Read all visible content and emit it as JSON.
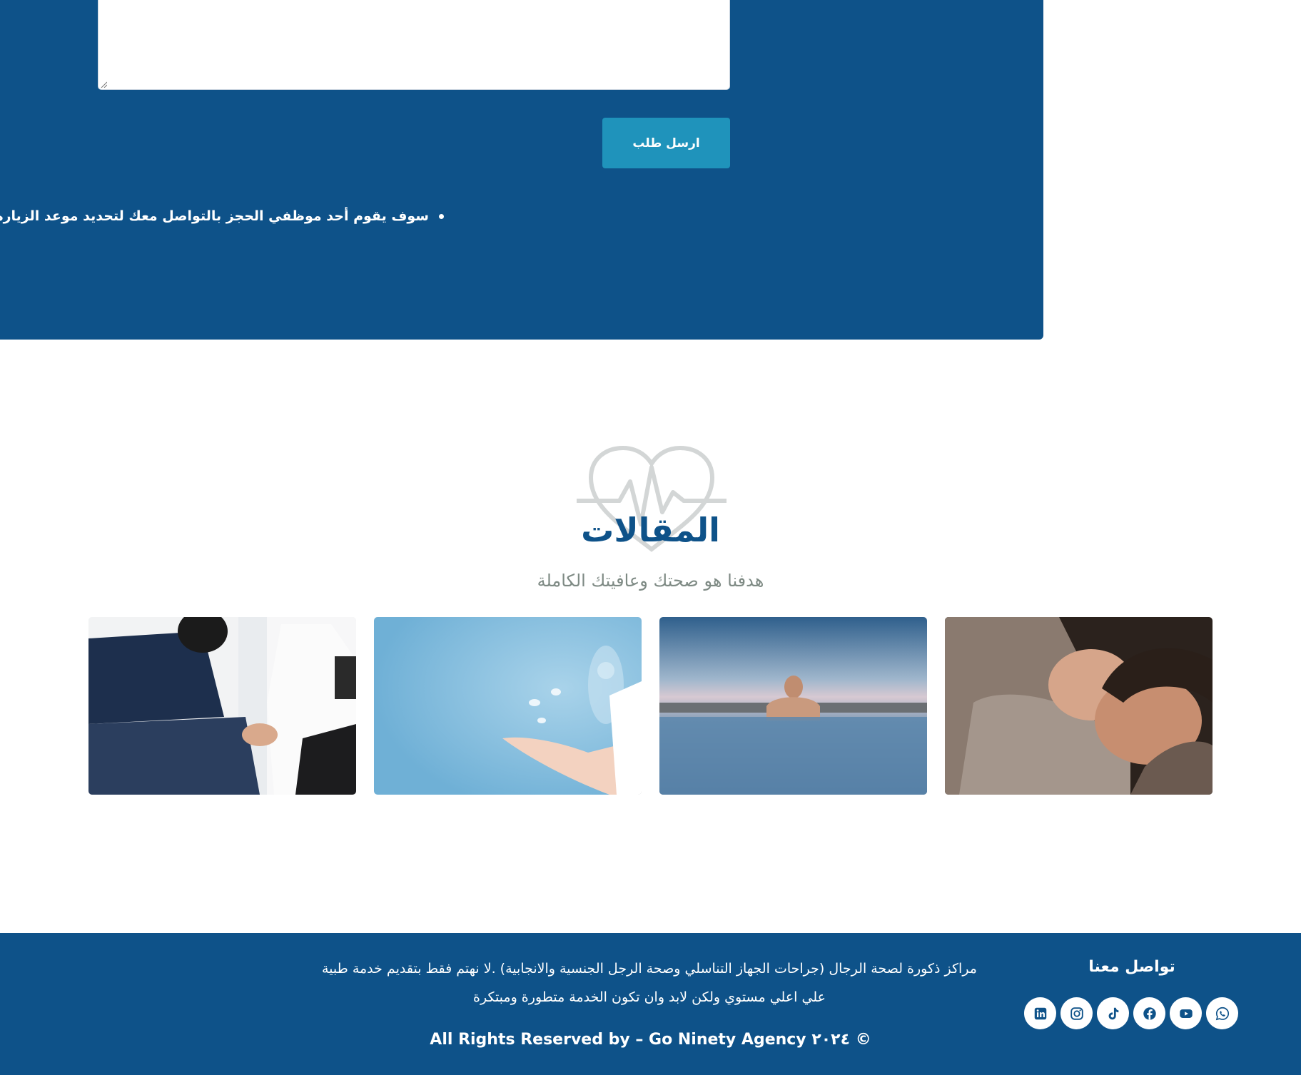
{
  "booking": {
    "textarea_value": "",
    "submit_label": "ارسل طلب",
    "note": "سوف يقوم أحد موظفي الحجز بالتواصل معك لتحديد موعد الزيارة"
  },
  "articles": {
    "title": "المقالات",
    "subtitle": "هدفنا هو صحتك وعافيتك الكاملة",
    "cards": [
      {
        "image": "father-with-newborn-photo"
      },
      {
        "image": "man-in-water-photo"
      },
      {
        "image": "hand-with-sperm-photo"
      },
      {
        "image": "patient-with-doctor-photo"
      }
    ]
  },
  "footer": {
    "contact_title": "تواصل معنا",
    "about": "مراكز ذكورة لصحة الرجال (جراحات الجهاز التناسلي وصحة الرجل الجنسية والانجابية) .لا نهتم فقط بتقديم خدمة طبية علي اعلي مستوي ولكن لابد وان تكون الخدمة متطورة ومبتكرة",
    "copyright": "All Rights Reserved by – Go Ninety Agency ٢٠٢٤ ©",
    "socials": [
      "linkedin-icon",
      "instagram-icon",
      "tiktok-icon",
      "facebook-icon",
      "youtube-icon",
      "whatsapp-icon"
    ]
  },
  "colors": {
    "brand_blue": "#0e5289",
    "button_teal": "#1f93bb",
    "subtitle_gray": "#7e8a84"
  }
}
